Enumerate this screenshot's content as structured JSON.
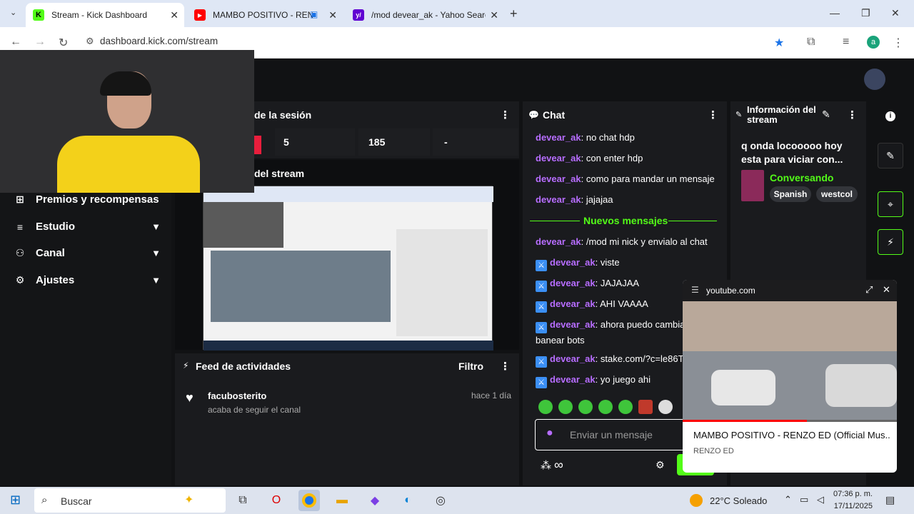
{
  "browser": {
    "tabs": [
      {
        "title": "Stream - Kick Dashboard",
        "favicon": "K",
        "color": "#53fc18"
      },
      {
        "title": "MAMBO POSITIVO - RENZO",
        "favicon": "▶",
        "color": "#ff0000"
      },
      {
        "title": "/mod devear_ak - Yahoo Search",
        "favicon": "y/",
        "color": "#6001d2"
      }
    ],
    "url": "dashboard.kick.com/stream",
    "profile_initial": "a"
  },
  "stats": {
    "title": "de la sesión",
    "values": [
      "5",
      "185",
      "-"
    ],
    "stream_header": "del stream"
  },
  "nav": {
    "items": [
      {
        "label": "Premios y recompensas",
        "icon": "gift-icon"
      },
      {
        "label": "Estudio",
        "icon": "bars-icon"
      },
      {
        "label": "Canal",
        "icon": "users-icon"
      },
      {
        "label": "Ajustes",
        "icon": "gear-icon"
      }
    ]
  },
  "activity": {
    "title": "Feed de actividades",
    "filter_label": "Filtro",
    "items": [
      {
        "user": "facubosterito",
        "action": "acaba de seguir el canal",
        "time": "hace 1 día"
      }
    ]
  },
  "chat": {
    "title": "Chat",
    "messages_top": [
      {
        "user": "devear_ak",
        "text": ": no chat hdp"
      },
      {
        "user": "devear_ak",
        "text": ": con enter hdp"
      },
      {
        "user": "devear_ak",
        "text": ": como para mandar un mensaje"
      },
      {
        "user": "devear_ak",
        "text": ": jajajaa"
      }
    ],
    "new_messages_label": "Nuevos mensajes",
    "messages_bottom": [
      {
        "user": "devear_ak",
        "text": ": /mod mi nick y envialo al chat",
        "badge": false
      },
      {
        "user": "devear_ak",
        "text": ": viste",
        "badge": true
      },
      {
        "user": "devear_ak",
        "text": ": JAJAJAA",
        "badge": true
      },
      {
        "user": "devear_ak",
        "text": ": AHI VAAAA",
        "badge": true
      },
      {
        "user": "devear_ak",
        "text": ": ahora puedo cambia y banear bots",
        "badge": true
      },
      {
        "user": "devear_ak",
        "text": ": stake.com/?c=le86T",
        "badge": true
      },
      {
        "user": "devear_ak",
        "text": ": yo juego ahi",
        "badge": true
      }
    ],
    "input_placeholder": "Enviar un mensaje",
    "accent": "#53fc18",
    "username_color": "#b76dff"
  },
  "stream_info": {
    "title": "Información del stream",
    "stream_title": "q onda locooooo hoy esta para viciar con...",
    "category": "Conversando",
    "tags": [
      "Spanish",
      "westcol"
    ]
  },
  "pip": {
    "source": "youtube.com",
    "video_title": "MAMBO POSITIVO - RENZO ED (Official Mus...",
    "channel": "RENZO ED",
    "progress": 0.58
  },
  "taskbar": {
    "search_placeholder": "Buscar",
    "weather": "22°C Soleado",
    "time": "07:36 p. m.",
    "date": "17/11/2025"
  }
}
